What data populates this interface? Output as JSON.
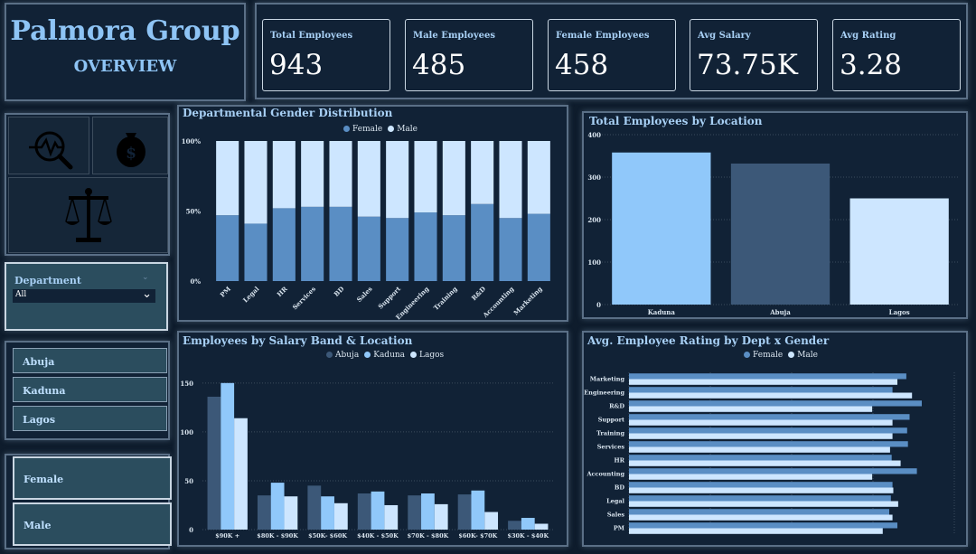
{
  "header": {
    "company": "Palmora Group",
    "subtitle": "OVERVIEW"
  },
  "kpis": [
    {
      "label": "Total Employees",
      "value": "943"
    },
    {
      "label": "Male Employees",
      "value": "485"
    },
    {
      "label": "Female Employees",
      "value": "458"
    },
    {
      "label": "Avg Salary",
      "value": "73.75K"
    },
    {
      "label": "Avg Rating",
      "value": "3.28"
    }
  ],
  "icons": [
    "analytics-icon",
    "money-bag-icon",
    "scales-of-justice-icon"
  ],
  "filters": {
    "department": {
      "label": "Department",
      "value": "All"
    },
    "locations": [
      "Abuja",
      "Kaduna",
      "Lagos"
    ],
    "genders": [
      "Female",
      "Male"
    ]
  },
  "colors": {
    "female": "#5a8ec4",
    "male": "#cde6ff",
    "abuja": "#3c5878",
    "kaduna": "#90c8fa",
    "lagos": "#cde6ff",
    "accent": "#a8d0f5"
  },
  "chart_data": [
    {
      "type": "bar",
      "stacked": "100%",
      "title": "Departmental Gender Distribution",
      "categories": [
        "PM",
        "Legal",
        "HR",
        "Services",
        "BD",
        "Sales",
        "Support",
        "Engineering",
        "Training",
        "R&D",
        "Accounting",
        "Marketing"
      ],
      "series": [
        {
          "name": "Female",
          "values": [
            47,
            41,
            52,
            53,
            53,
            46,
            45,
            49,
            47,
            55,
            45,
            48
          ]
        },
        {
          "name": "Male",
          "values": [
            53,
            59,
            48,
            47,
            47,
            54,
            55,
            51,
            53,
            45,
            55,
            52
          ]
        }
      ],
      "yticks": [
        "100%",
        "50%",
        "0%"
      ],
      "ylim": [
        0,
        100
      ],
      "legend": "top"
    },
    {
      "type": "bar",
      "title": "Total Employees by Location",
      "categories": [
        "Kaduna",
        "Abuja",
        "Lagos"
      ],
      "values": [
        358,
        332,
        250
      ],
      "ylim": [
        0,
        400
      ],
      "yticks": [
        0,
        100,
        200,
        300,
        400
      ],
      "grid": true
    },
    {
      "type": "bar",
      "title": "Employees by Salary Band & Location",
      "categories": [
        "$90K +",
        "$80K - $90K",
        "$50K- $60K",
        "$40K - $50K",
        "$70K - $80K",
        "$60K- $70K",
        "$30K - $40K"
      ],
      "series": [
        {
          "name": "Abuja",
          "values": [
            136,
            35,
            45,
            37,
            35,
            36,
            9
          ]
        },
        {
          "name": "Kaduna",
          "values": [
            150,
            48,
            34,
            39,
            37,
            40,
            12
          ]
        },
        {
          "name": "Lagos",
          "values": [
            114,
            34,
            27,
            25,
            26,
            18,
            6
          ]
        }
      ],
      "ylim": [
        0,
        160
      ],
      "yticks": [
        0,
        50,
        100,
        150
      ],
      "legend": "top",
      "grid": true
    },
    {
      "type": "bar",
      "orientation": "horizontal",
      "title": "Avg. Employee Rating by Dept x Gender",
      "categories": [
        "Marketing",
        "Engineering",
        "R&D",
        "Support",
        "Training",
        "Services",
        "HR",
        "Accounting",
        "BD",
        "Legal",
        "Sales",
        "PM"
      ],
      "series": [
        {
          "name": "Female",
          "values": [
            3.41,
            3.24,
            3.6,
            3.45,
            3.42,
            3.43,
            3.23,
            3.54,
            3.24,
            3.22,
            3.2,
            3.3
          ]
        },
        {
          "name": "Male",
          "values": [
            3.3,
            3.48,
            2.99,
            3.24,
            3.24,
            3.21,
            3.34,
            2.99,
            3.25,
            3.31,
            3.24,
            3.12
          ]
        }
      ],
      "xlim": [
        0,
        4
      ],
      "legend": "top",
      "grid": true
    }
  ]
}
